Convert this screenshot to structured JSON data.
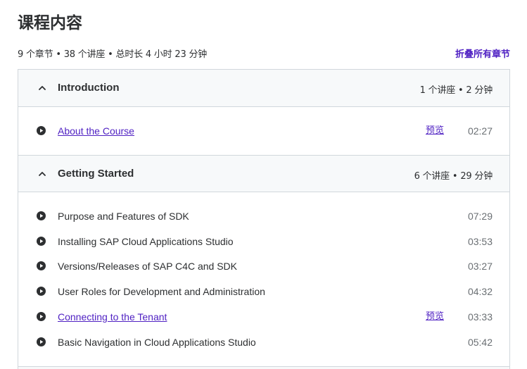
{
  "page": {
    "title": "课程内容",
    "summary": "9 个章节 • 38 个讲座 • 总时长 4 小时 23 分钟",
    "collapse_all": "折叠所有章节"
  },
  "sections": [
    {
      "title": "Introduction",
      "meta": "1 个讲座 • 2 分钟",
      "lectures": [
        {
          "title": "About the Course",
          "preview": "预览",
          "duration": "02:27"
        }
      ]
    },
    {
      "title": "Getting Started",
      "meta": "6 个讲座 • 29 分钟",
      "lectures": [
        {
          "title": "Purpose and Features of SDK",
          "duration": "07:29"
        },
        {
          "title": "Installing SAP Cloud Applications Studio",
          "duration": "03:53"
        },
        {
          "title": "Versions/Releases of SAP C4C and SDK",
          "duration": "03:27"
        },
        {
          "title": "User Roles for Development and Administration",
          "duration": "04:32"
        },
        {
          "title": "Connecting to the Tenant",
          "preview": "预览",
          "duration": "03:33"
        },
        {
          "title": "Basic Navigation in Cloud Applications Studio",
          "duration": "05:42"
        }
      ]
    }
  ],
  "icons": {
    "chevron": "chevron-up-icon",
    "play": "play-circle-icon"
  },
  "colors": {
    "link": "#5022c3",
    "text": "#2d2f31",
    "muted": "#6a6f73",
    "header_bg": "#f7f9fa",
    "border": "#d1d7dc"
  }
}
